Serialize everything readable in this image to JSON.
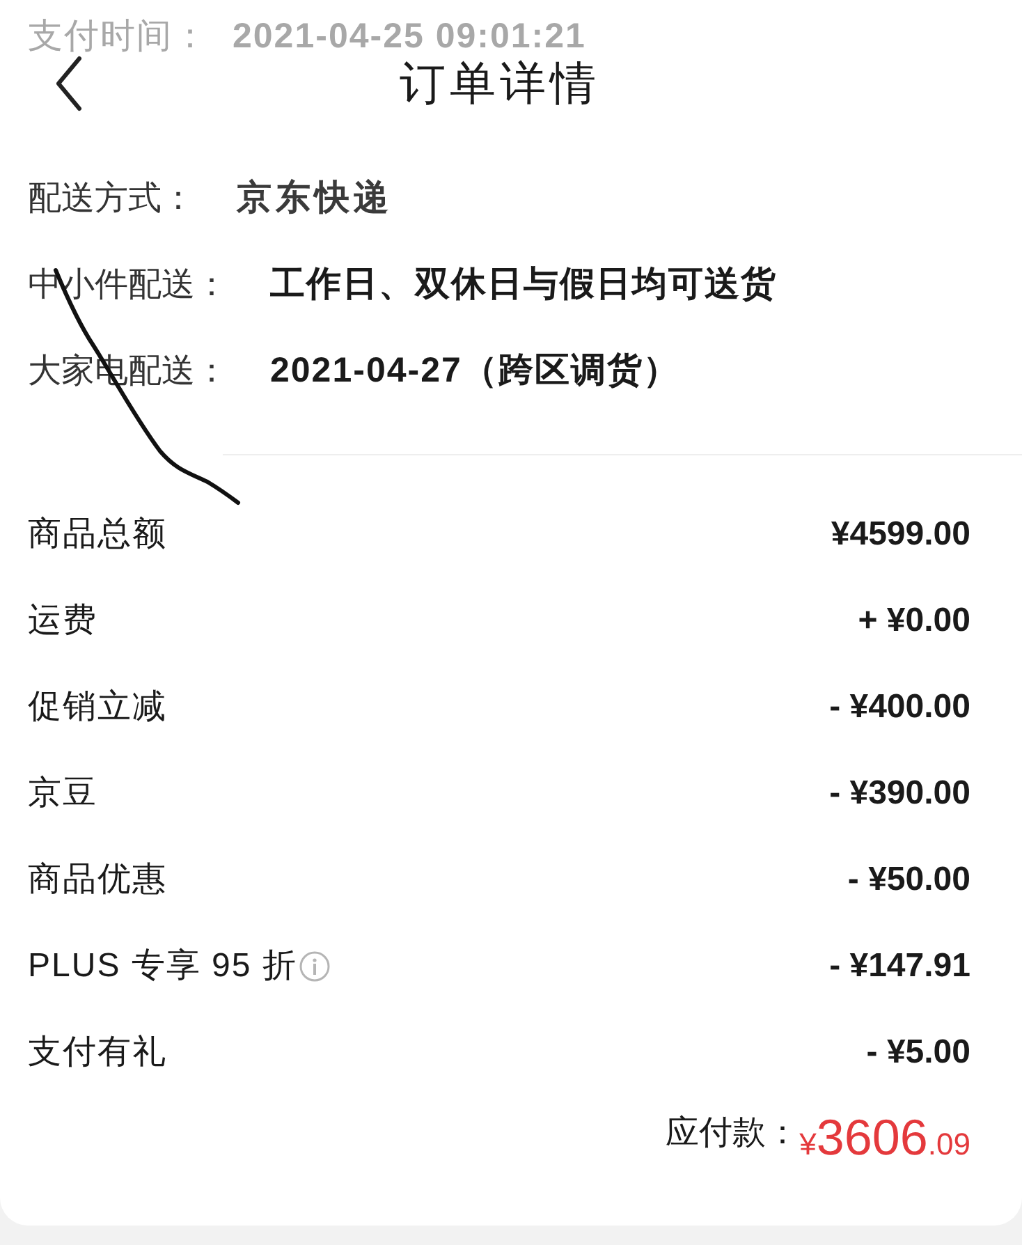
{
  "header": {
    "faded_row": {
      "label": "支付时间：",
      "value": "2021-04-25 09:01:21"
    },
    "title": "订单详情"
  },
  "delivery": [
    {
      "label": "配送方式：",
      "value": "京东快递",
      "kind": "brand"
    },
    {
      "label": "中小件配送：",
      "value": "工作日、双休日与假日均可送货",
      "kind": "plain"
    },
    {
      "label": "大家电配送：",
      "value": "2021-04-27（跨区调货）",
      "kind": "plain"
    }
  ],
  "charges": [
    {
      "label": "商品总额",
      "amount": "¥4599.00",
      "info": false
    },
    {
      "label": "运费",
      "amount": "+ ¥0.00",
      "info": false
    },
    {
      "label": "促销立减",
      "amount": "- ¥400.00",
      "info": false
    },
    {
      "label": "京豆",
      "amount": "- ¥390.00",
      "info": false
    },
    {
      "label": "商品优惠",
      "amount": "- ¥50.00",
      "info": false
    },
    {
      "label": "PLUS 专享 95 折",
      "amount": "- ¥147.91",
      "info": true
    },
    {
      "label": "支付有礼",
      "amount": "- ¥5.00",
      "info": false
    }
  ],
  "total": {
    "label": "应付款：",
    "currency": "¥",
    "integer": "3606",
    "decimal": ".09"
  }
}
